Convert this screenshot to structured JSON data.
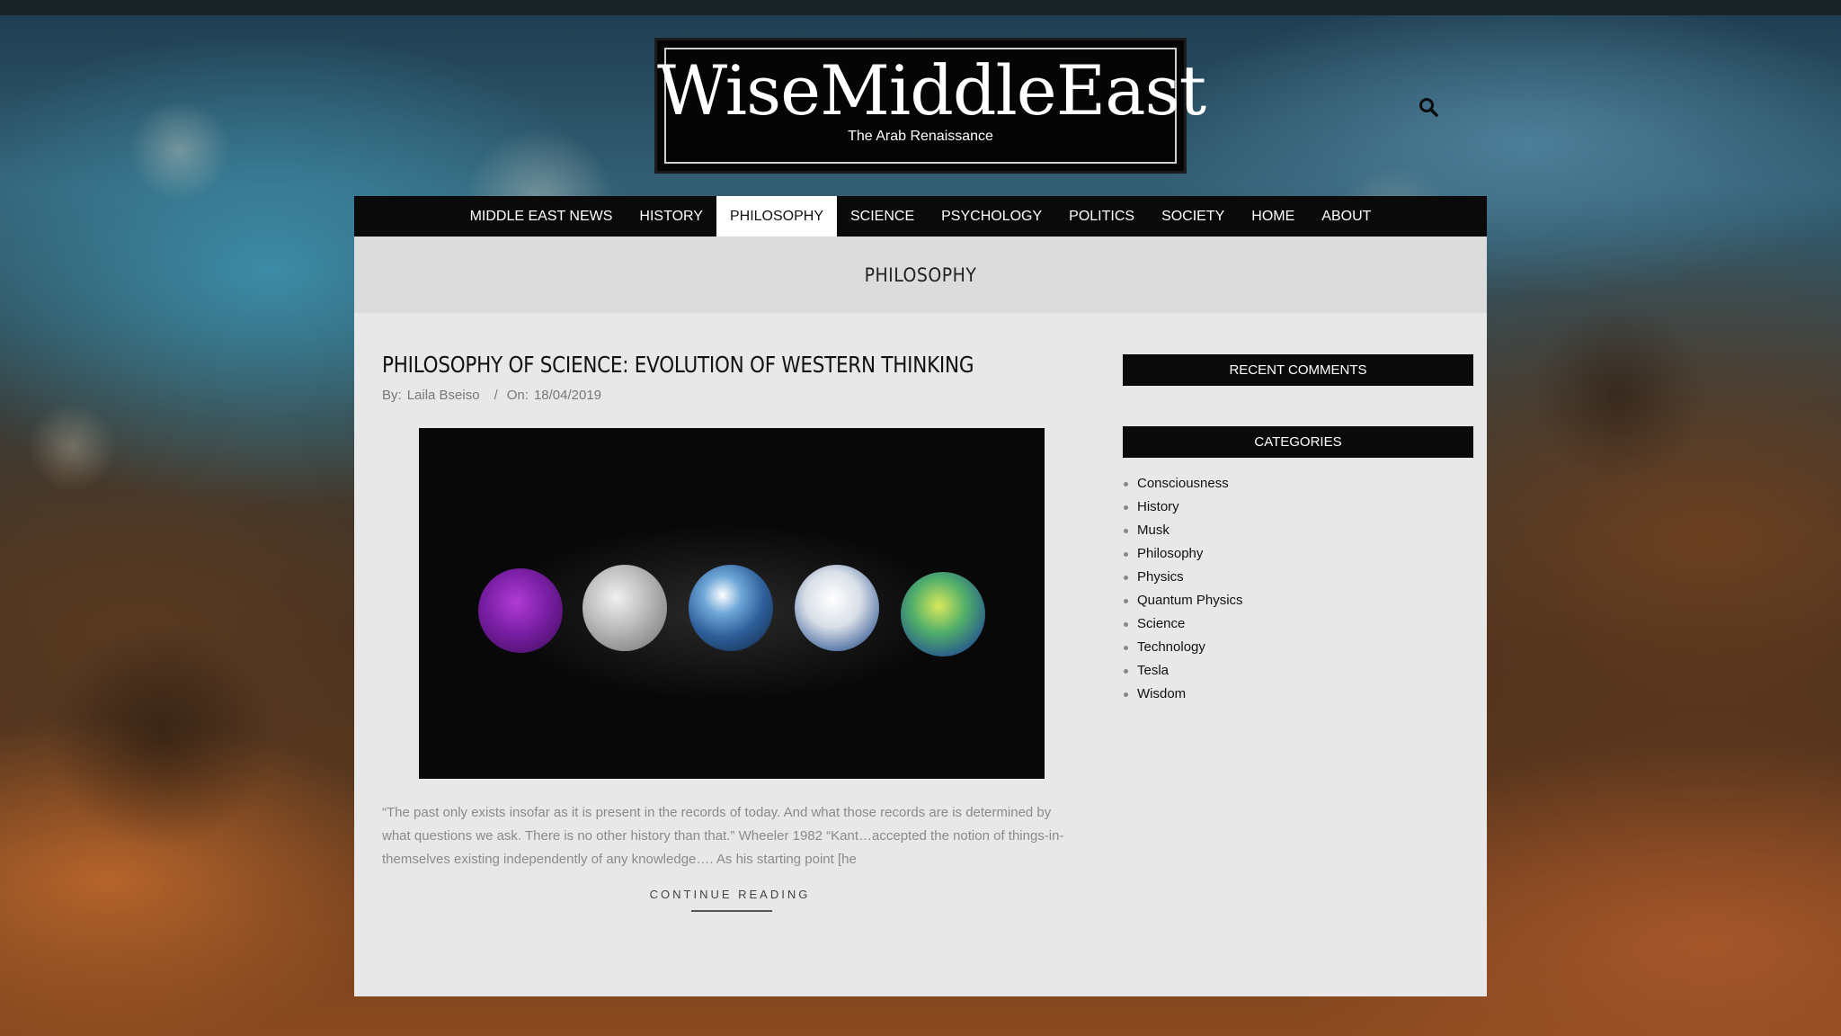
{
  "site": {
    "title": "WiseMiddleEast",
    "tagline": "The Arab Renaissance"
  },
  "nav": {
    "items": [
      {
        "label": "MIDDLE EAST NEWS",
        "active": false
      },
      {
        "label": "HISTORY",
        "active": false
      },
      {
        "label": "PHILOSOPHY",
        "active": true
      },
      {
        "label": "SCIENCE",
        "active": false
      },
      {
        "label": "PSYCHOLOGY",
        "active": false
      },
      {
        "label": "POLITICS",
        "active": false
      },
      {
        "label": "SOCIETY",
        "active": false
      },
      {
        "label": "HOME",
        "active": false
      },
      {
        "label": "ABOUT",
        "active": false
      }
    ]
  },
  "page": {
    "category_title": "PHILOSOPHY"
  },
  "post": {
    "title": "PHILOSOPHY OF SCIENCE: EVOLUTION OF WESTERN THINKING",
    "by_label": "By:",
    "author": "Laila Bseiso",
    "sep": "/",
    "on_label": "On:",
    "date": "18/04/2019",
    "excerpt": "“The past only exists insofar as it is present in the records of today. And what those records are is determined by what questions we ask. There is no other history than that.” Wheeler 1982 “Kant…accepted the notion of things-in-themselves existing independently of any knowledge…. As his starting point [he",
    "continue_label": "CONTINUE READING"
  },
  "sidebar": {
    "recent_comments_title": "RECENT COMMENTS",
    "categories_title": "CATEGORIES",
    "categories": [
      "Consciousness",
      "History",
      "Musk",
      "Philosophy",
      "Physics",
      "Quantum Physics",
      "Science",
      "Technology",
      "Tesla",
      "Wisdom"
    ]
  },
  "icons": {
    "search": "search-icon"
  }
}
